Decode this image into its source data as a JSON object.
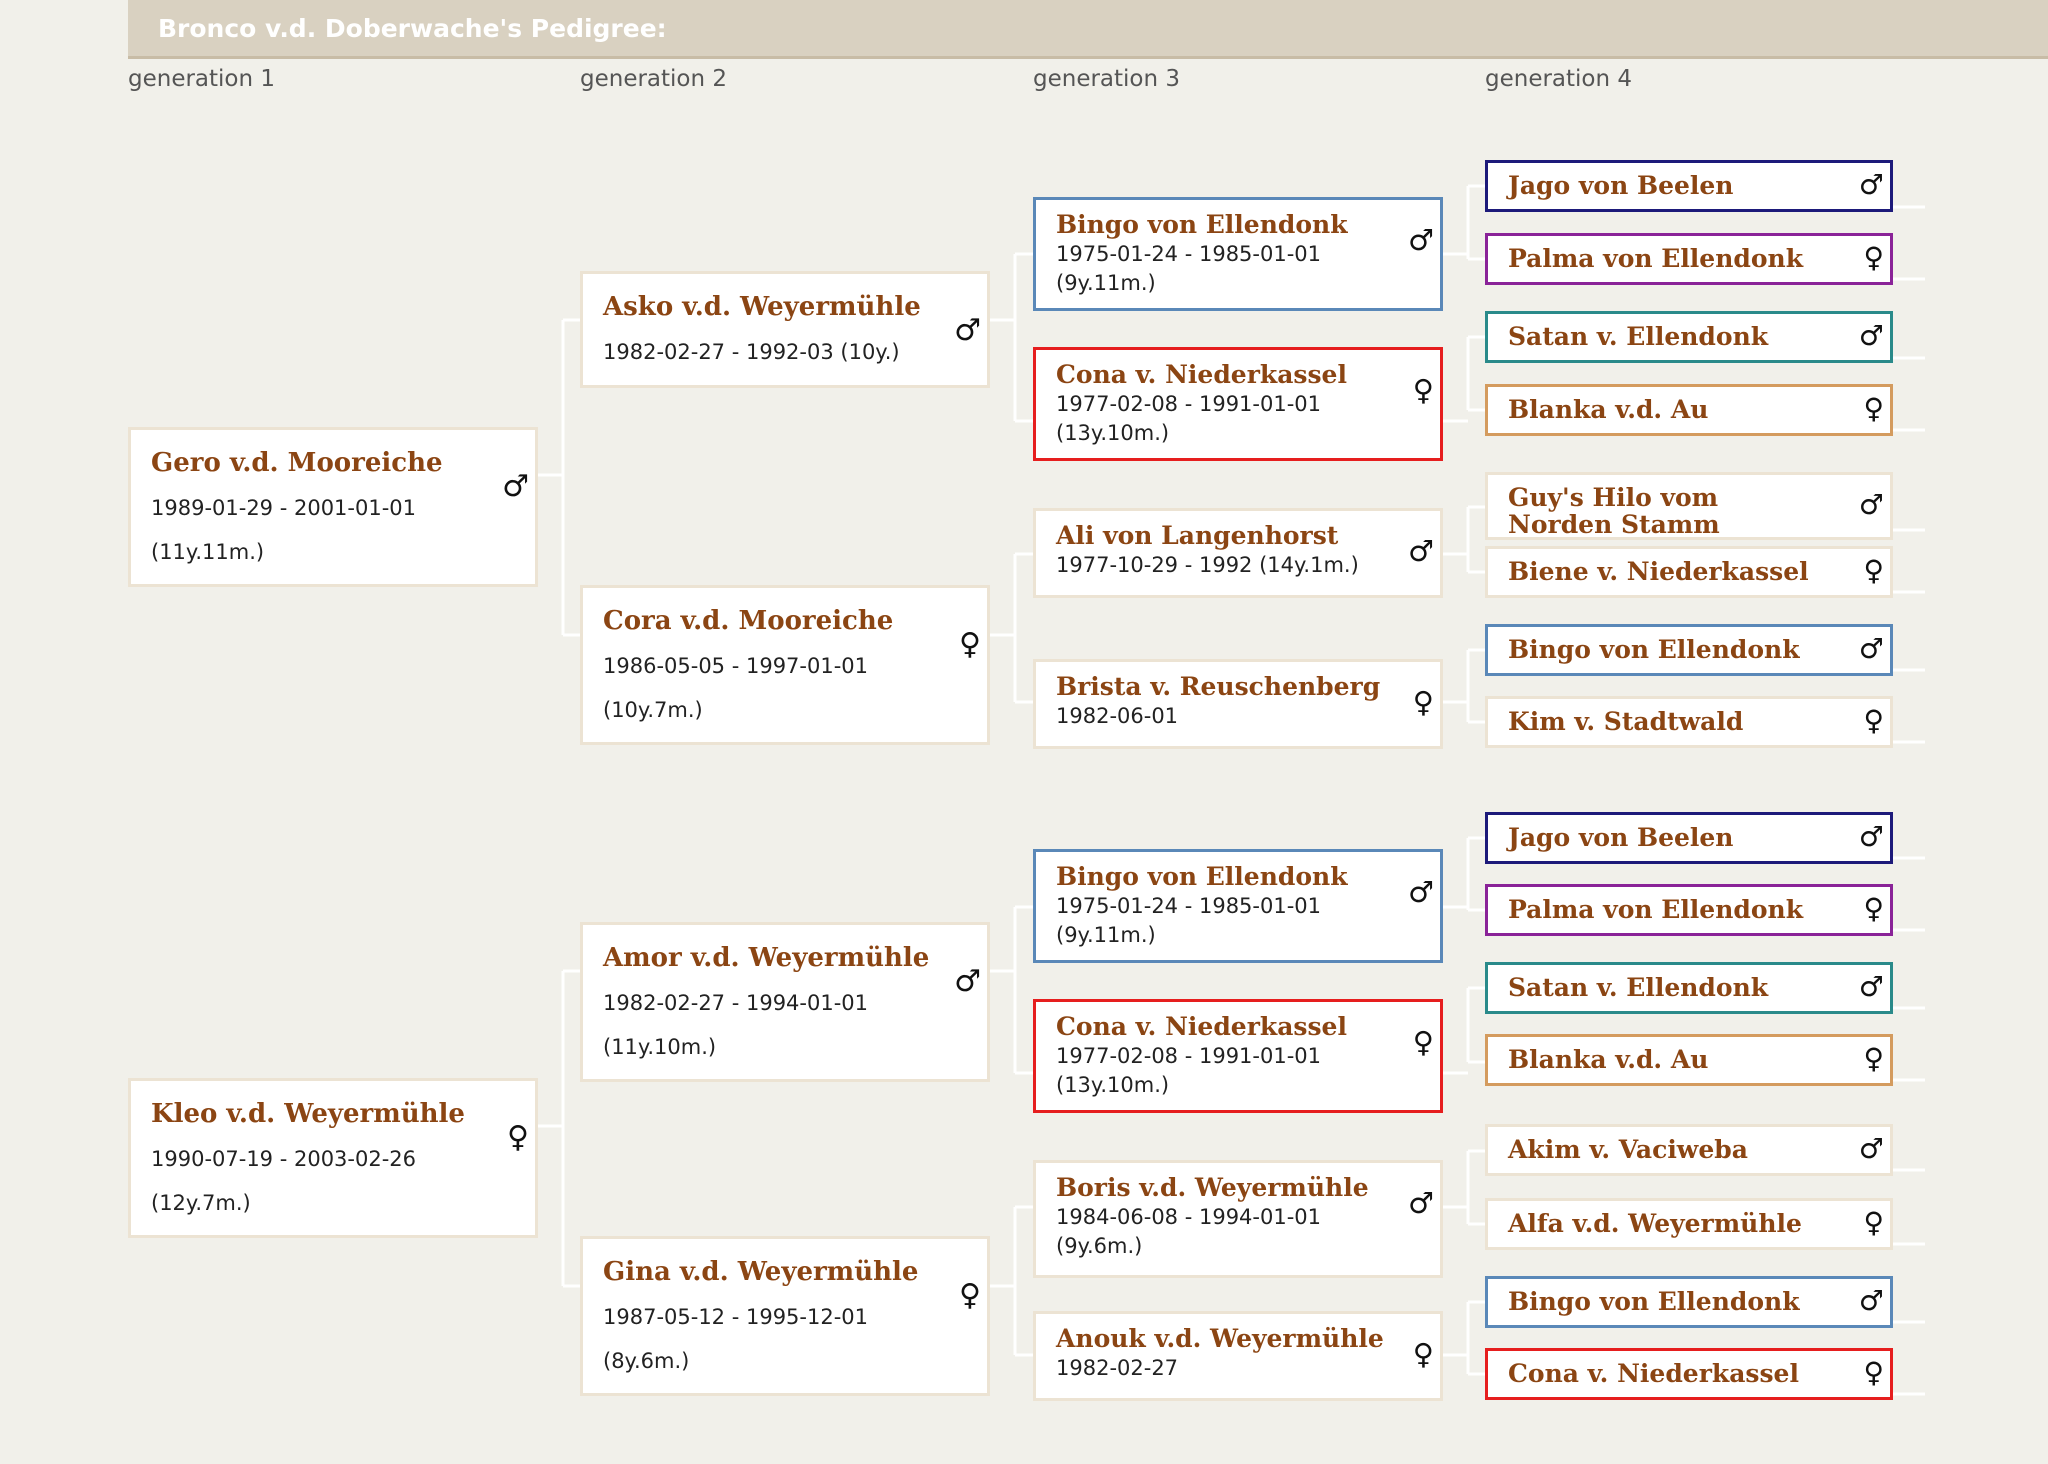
{
  "title": "Bronco v.d. Doberwache's Pedigree:",
  "generation_labels": [
    "generation 1",
    "generation 2",
    "generation 3",
    "generation 4"
  ],
  "male_symbol": "♂",
  "female_symbol": "♀",
  "border_colors": {
    "default": "#ece3d3",
    "navy": "#1d1a7a",
    "purple": "#8a2398",
    "teal": "#2a8a8a",
    "orange": "#d49b5e",
    "blue": "#5a88b8",
    "red": "#e61e1e"
  },
  "dogs": {
    "gero": {
      "name": "Gero v.d. Mooreiche",
      "dates": "1989-01-29 - 2001-01-01",
      "age": "(11y.11m.)",
      "sex": "♂"
    },
    "kleo": {
      "name": "Kleo v.d. Weyermühle",
      "dates": "1990-07-19 - 2003-02-26",
      "age": "(12y.7m.)",
      "sex": "♀"
    },
    "asko": {
      "name": "Asko v.d. Weyermühle",
      "dates": "1982-02-27 - 1992-03 (10y.)",
      "age": "",
      "sex": "♂"
    },
    "cora": {
      "name": "Cora v.d. Mooreiche",
      "dates": "1986-05-05 - 1997-01-01",
      "age": "(10y.7m.)",
      "sex": "♀"
    },
    "amor": {
      "name": "Amor v.d. Weyermühle",
      "dates": "1982-02-27 - 1994-01-01",
      "age": "(11y.10m.)",
      "sex": "♂"
    },
    "gina": {
      "name": "Gina v.d. Weyermühle",
      "dates": "1987-05-12 - 1995-12-01",
      "age": "(8y.6m.)",
      "sex": "♀"
    },
    "bingo_1": {
      "name": "Bingo von Ellendonk",
      "dates": "1975-01-24 - 1985-01-01",
      "age": "(9y.11m.)",
      "sex": "♂"
    },
    "cona_1": {
      "name": "Cona v. Niederkassel",
      "dates": "1977-02-08 - 1991-01-01",
      "age": "(13y.10m.)",
      "sex": "♀"
    },
    "ali": {
      "name": "Ali von Langenhorst",
      "dates": "1977-10-29 - 1992 (14y.1m.)",
      "age": "",
      "sex": "♂"
    },
    "brista": {
      "name": "Brista v. Reuschenberg",
      "dates": "1982-06-01",
      "age": "",
      "sex": "♀"
    },
    "bingo_2": {
      "name": "Bingo von Ellendonk",
      "dates": "1975-01-24 - 1985-01-01",
      "age": "(9y.11m.)",
      "sex": "♂"
    },
    "cona_2": {
      "name": "Cona v. Niederkassel",
      "dates": "1977-02-08 - 1991-01-01",
      "age": "(13y.10m.)",
      "sex": "♀"
    },
    "boris": {
      "name": "Boris v.d. Weyermühle",
      "dates": "1984-06-08 - 1994-01-01",
      "age": "(9y.6m.)",
      "sex": "♂"
    },
    "anouk": {
      "name": "Anouk v.d. Weyermühle",
      "dates": "1982-02-27",
      "age": "",
      "sex": "♀"
    },
    "g4_1": {
      "name": "Jago von Beelen",
      "sex": "♂"
    },
    "g4_2": {
      "name": "Palma von Ellendonk",
      "sex": "♀"
    },
    "g4_3": {
      "name": "Satan v. Ellendonk",
      "sex": "♂"
    },
    "g4_4": {
      "name": "Blanka v.d. Au",
      "sex": "♀"
    },
    "g4_5": {
      "name": "Guy's Hilo vom Norden Stamm",
      "sex": "♂"
    },
    "g4_6": {
      "name": "Biene v. Niederkassel",
      "sex": "♀"
    },
    "g4_7": {
      "name": "Bingo von Ellendonk",
      "sex": "♂"
    },
    "g4_8": {
      "name": "Kim v. Stadtwald",
      "sex": "♀"
    },
    "g4_9": {
      "name": "Jago von Beelen",
      "sex": "♂"
    },
    "g4_10": {
      "name": "Palma von Ellendonk",
      "sex": "♀"
    },
    "g4_11": {
      "name": "Satan v. Ellendonk",
      "sex": "♂"
    },
    "g4_12": {
      "name": "Blanka v.d. Au",
      "sex": "♀"
    },
    "g4_13": {
      "name": "Akim v. Vaciweba",
      "sex": "♂"
    },
    "g4_14": {
      "name": "Alfa v.d. Weyermühle",
      "sex": "♀"
    },
    "g4_15": {
      "name": "Bingo von Ellendonk",
      "sex": "♂"
    },
    "g4_16": {
      "name": "Cona v. Niederkassel",
      "sex": "♀"
    }
  }
}
